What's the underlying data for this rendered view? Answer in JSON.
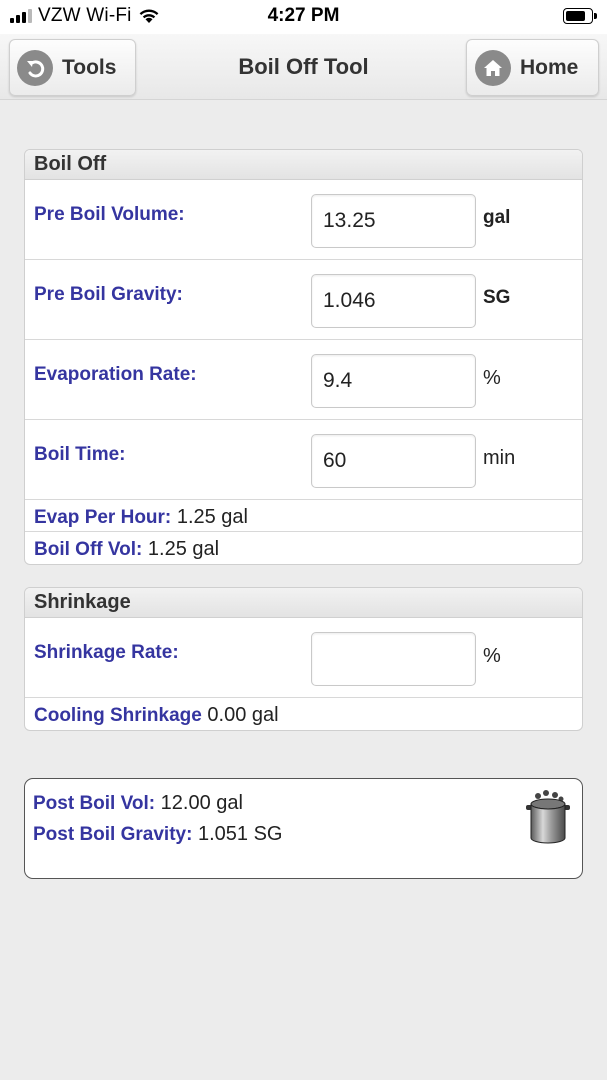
{
  "status_bar": {
    "carrier": "VZW Wi-Fi",
    "time": "4:27 PM"
  },
  "header": {
    "back_label": "Tools",
    "title": "Boil Off Tool",
    "home_label": "Home"
  },
  "boil_off": {
    "heading": "Boil Off",
    "pre_boil_volume": {
      "label": "Pre Boil Volume:",
      "value": "13.25",
      "unit": "gal"
    },
    "pre_boil_gravity": {
      "label": "Pre Boil Gravity:",
      "value": "1.046",
      "unit": "SG"
    },
    "evaporation_rate": {
      "label": "Evaporation Rate:",
      "value": "9.4",
      "unit": "%"
    },
    "boil_time": {
      "label": "Boil Time:",
      "value": "60",
      "unit": "min"
    },
    "evap_per_hour": {
      "label": "Evap Per Hour:",
      "value": "1.25 gal"
    },
    "boil_off_vol": {
      "label": "Boil Off Vol:",
      "value": "1.25 gal"
    }
  },
  "shrinkage": {
    "heading": "Shrinkage",
    "shrinkage_rate": {
      "label": "Shrinkage Rate:",
      "value": "",
      "unit": "%"
    },
    "cooling_shrinkage": {
      "label": "Cooling Shrinkage",
      "value": "0.00 gal"
    }
  },
  "results": {
    "post_boil_vol": {
      "label": "Post Boil Vol:",
      "value": "12.00 gal"
    },
    "post_boil_gravity": {
      "label": "Post Boil Gravity:",
      "value": "1.051 SG"
    },
    "icon": "brew-kettle-icon"
  }
}
